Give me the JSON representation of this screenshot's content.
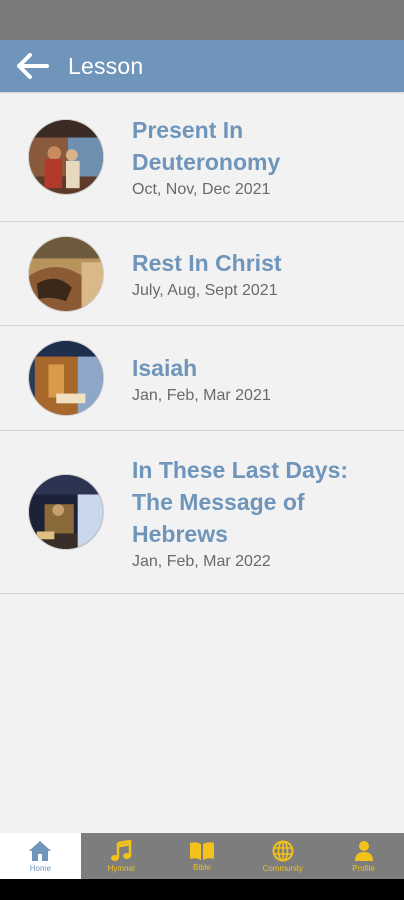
{
  "app_bar": {
    "title": "Lesson"
  },
  "lessons": [
    {
      "title": "Present In Deuteronomy",
      "dates": "Oct, Nov, Dec 2021"
    },
    {
      "title": "Rest In Christ",
      "dates": "July, Aug, Sept 2021"
    },
    {
      "title": "Isaiah",
      "dates": "Jan, Feb, Mar 2021"
    },
    {
      "title": "In These Last Days: The Message of Hebrews",
      "dates": "Jan, Feb, Mar 2022"
    }
  ],
  "bottom_nav": [
    {
      "label": "Home",
      "icon": "home-icon",
      "active": true
    },
    {
      "label": "Hymnal",
      "icon": "music-note-icon"
    },
    {
      "label": "Bible",
      "icon": "book-icon"
    },
    {
      "label": "Community",
      "icon": "globe-icon"
    },
    {
      "label": "Profile",
      "icon": "person-icon"
    }
  ],
  "colors": {
    "accent": "#6f95bb",
    "nav_icon": "#f2c21b",
    "status_bar": "#7a7a7a"
  }
}
